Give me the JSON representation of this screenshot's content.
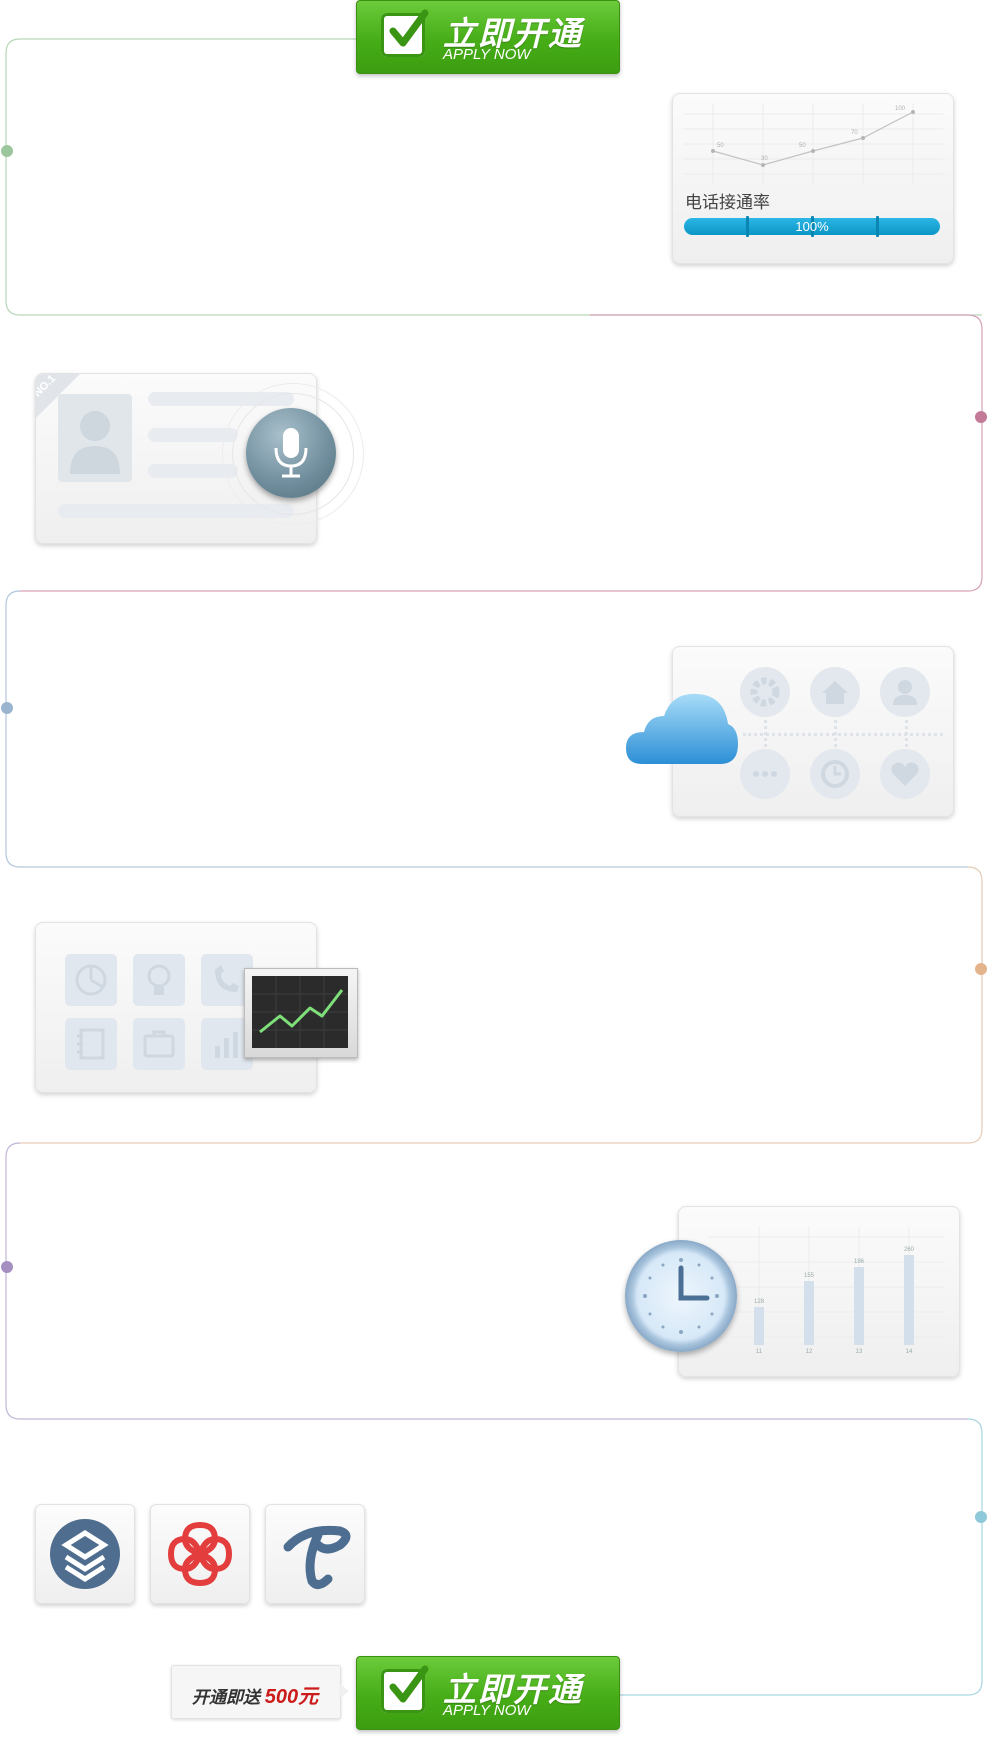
{
  "apply_button": {
    "title": "立即开通",
    "subtitle": "APPLY NOW"
  },
  "call_rate_card": {
    "title": "电话接通率",
    "progress_label": "100%",
    "progress": 1.0,
    "mini_chart_labels": [
      "50",
      "30",
      "50",
      "70",
      "100"
    ]
  },
  "voice_card": {
    "badge": "NO.1"
  },
  "cloud_card": {
    "icons": [
      "gear-icon",
      "home-icon",
      "user-icon",
      "more-icon",
      "clock-icon",
      "heart-icon"
    ]
  },
  "stats_card": {
    "icons": [
      "pie-chart-icon",
      "lightbulb-icon",
      "phone-icon",
      "notebook-icon",
      "briefcase-icon",
      "bar-chart-icon"
    ]
  },
  "bar_card": {
    "values": [
      "128",
      "155",
      "196",
      "260"
    ],
    "categories": [
      "11",
      "12",
      "13",
      "14"
    ]
  },
  "carriers": [
    "china-mobile-logo",
    "china-unicom-logo",
    "china-telecom-logo"
  ],
  "gift": {
    "text": "开通即送",
    "amount": "500元"
  },
  "colors": {
    "green": "#46ad17",
    "timeline": [
      "#9cc79c",
      "#c27a98",
      "#9ab4d0",
      "#e3b48c",
      "#a58fc0",
      "#8dc9d8"
    ]
  }
}
